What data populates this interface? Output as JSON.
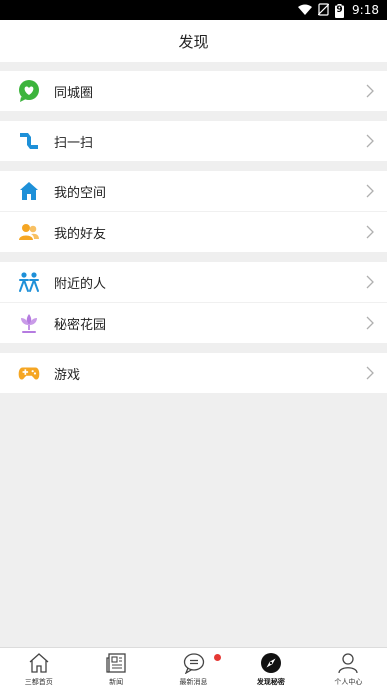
{
  "status_bar": {
    "time": "9:18",
    "battery_label": "9"
  },
  "header": {
    "title": "发现"
  },
  "groups": [
    {
      "items": [
        {
          "label": "同城圈",
          "icon": "heart-bubble-icon"
        }
      ]
    },
    {
      "items": [
        {
          "label": "扫一扫",
          "icon": "scan-icon"
        }
      ]
    },
    {
      "items": [
        {
          "label": "我的空间",
          "icon": "home-icon"
        },
        {
          "label": "我的好友",
          "icon": "friends-icon"
        }
      ]
    },
    {
      "items": [
        {
          "label": "附近的人",
          "icon": "nearby-people-icon"
        },
        {
          "label": "秘密花园",
          "icon": "lotus-icon"
        }
      ]
    },
    {
      "items": [
        {
          "label": "游戏",
          "icon": "gamepad-icon"
        }
      ]
    }
  ],
  "tabbar": {
    "tabs": [
      {
        "label": "三都首页",
        "icon": "home-outline-icon"
      },
      {
        "label": "新闻",
        "icon": "newspaper-icon"
      },
      {
        "label": "最新消息",
        "icon": "chat-bubble-icon",
        "badge": true
      },
      {
        "label": "发现秘密",
        "icon": "compass-icon",
        "active": true
      },
      {
        "label": "个人中心",
        "icon": "person-icon"
      }
    ]
  },
  "colors": {
    "green": "#3cb43c",
    "blue": "#1e90d8",
    "orange": "#f5a623",
    "purple": "#b57be0",
    "badge": "#e53935",
    "chevron": "#b0b0b0"
  }
}
